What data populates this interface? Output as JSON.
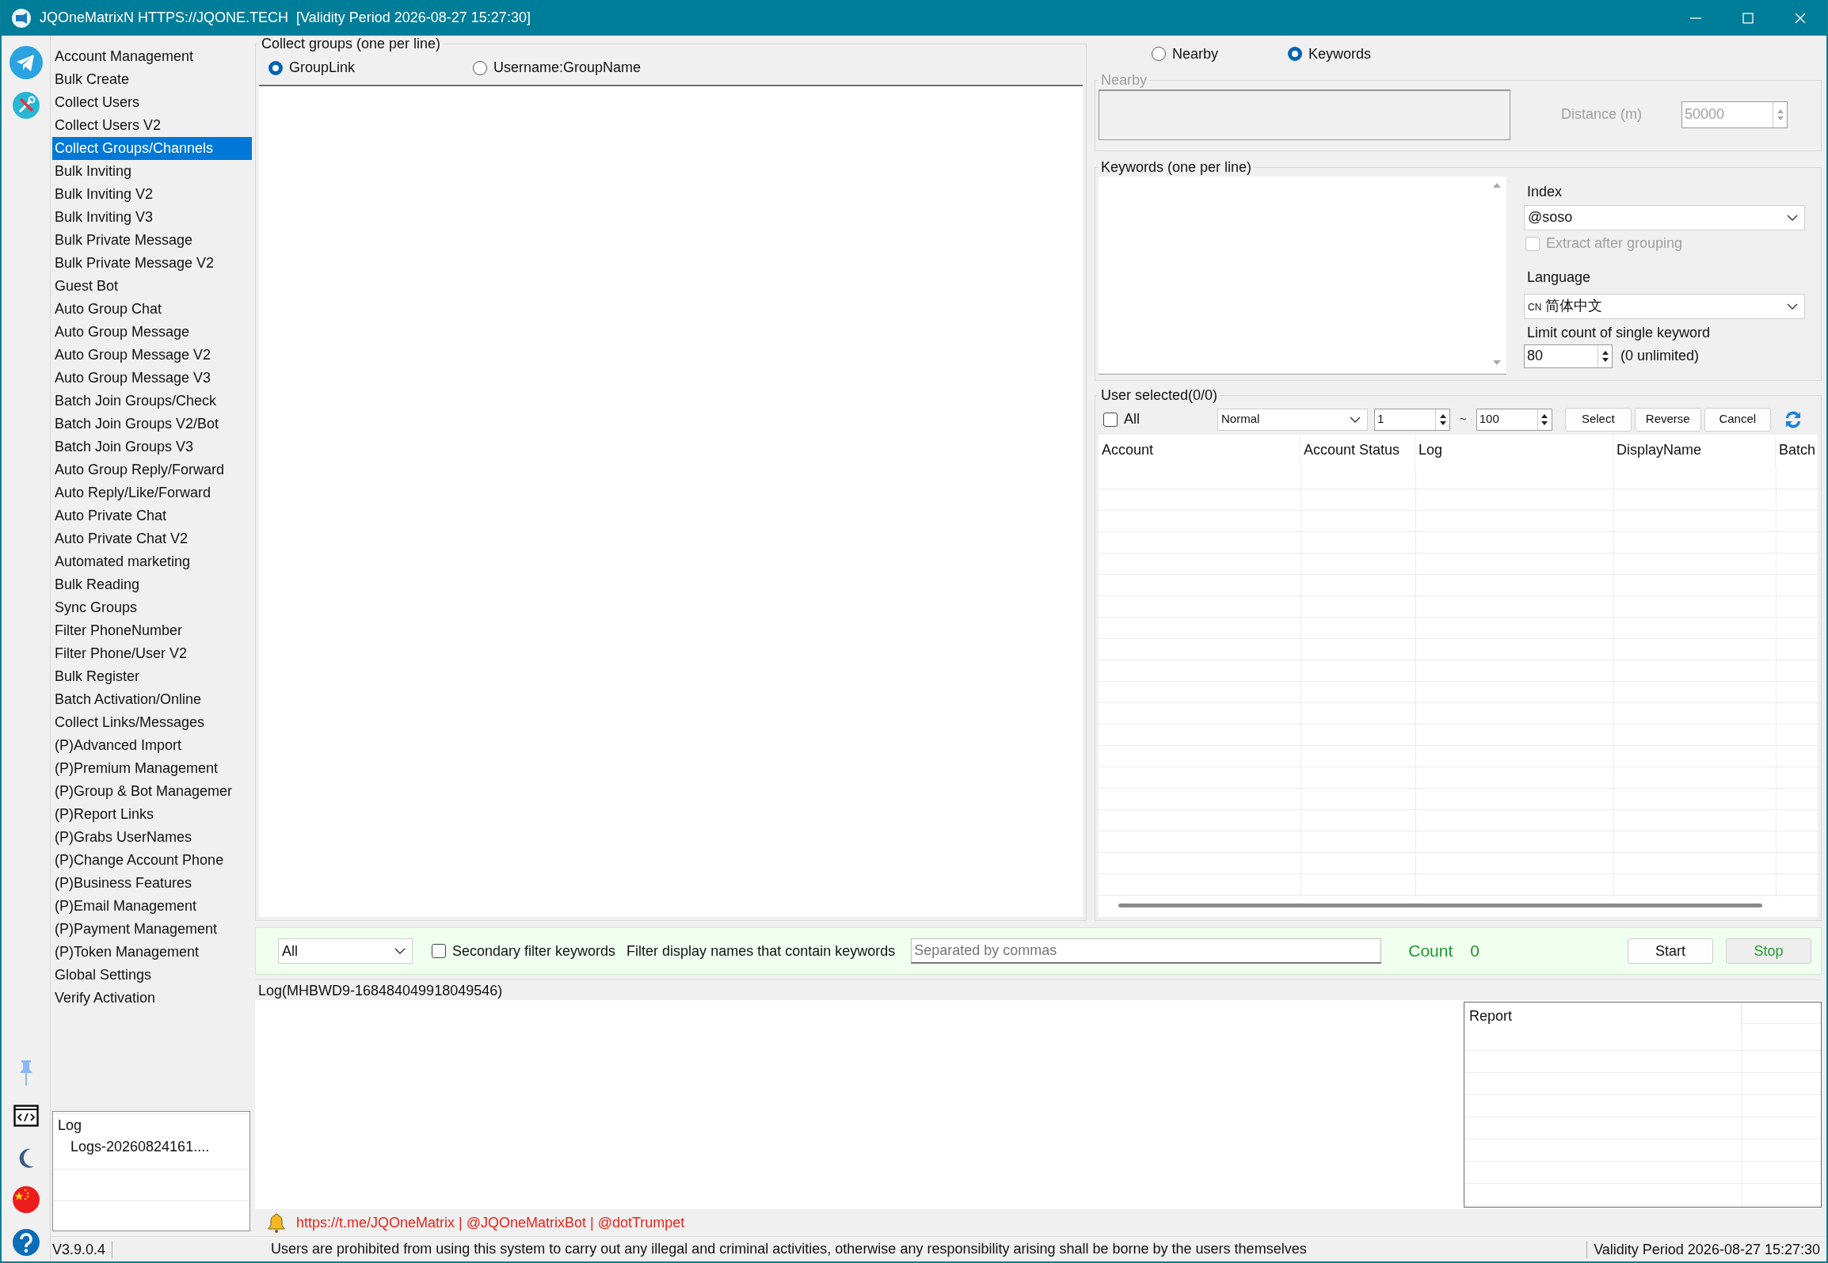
{
  "window": {
    "title": "JQOneMatrixN HTTPS://JQONE.TECH  [Validity Period 2026-08-27 15:27:30]"
  },
  "sidebar": {
    "items": [
      {
        "label": "Account Management",
        "selected": false
      },
      {
        "label": "Bulk Create",
        "selected": false
      },
      {
        "label": "Collect Users",
        "selected": false
      },
      {
        "label": "Collect Users V2",
        "selected": false
      },
      {
        "label": "Collect Groups/Channels",
        "selected": true
      },
      {
        "label": "Bulk Inviting",
        "selected": false
      },
      {
        "label": "Bulk Inviting V2",
        "selected": false
      },
      {
        "label": "Bulk Inviting V3",
        "selected": false
      },
      {
        "label": "Bulk Private Message",
        "selected": false
      },
      {
        "label": "Bulk Private Message V2",
        "selected": false
      },
      {
        "label": "Guest Bot",
        "selected": false
      },
      {
        "label": "Auto Group Chat",
        "selected": false
      },
      {
        "label": "Auto Group Message",
        "selected": false
      },
      {
        "label": "Auto Group Message V2",
        "selected": false
      },
      {
        "label": "Auto Group Message V3",
        "selected": false
      },
      {
        "label": "Batch Join Groups/Check",
        "selected": false
      },
      {
        "label": "Batch Join Groups V2/Bot",
        "selected": false
      },
      {
        "label": "Batch Join Groups V3",
        "selected": false
      },
      {
        "label": "Auto Group Reply/Forward",
        "selected": false
      },
      {
        "label": "Auto Reply/Like/Forward",
        "selected": false
      },
      {
        "label": "Auto Private Chat",
        "selected": false
      },
      {
        "label": "Auto Private Chat V2",
        "selected": false
      },
      {
        "label": "Automated marketing",
        "selected": false
      },
      {
        "label": "Bulk Reading",
        "selected": false
      },
      {
        "label": "Sync Groups",
        "selected": false
      },
      {
        "label": "Filter PhoneNumber",
        "selected": false
      },
      {
        "label": "Filter Phone/User V2",
        "selected": false
      },
      {
        "label": "Bulk Register",
        "selected": false
      },
      {
        "label": "Batch Activation/Online",
        "selected": false
      },
      {
        "label": "Collect Links/Messages",
        "selected": false
      },
      {
        "label": "(P)Advanced Import",
        "selected": false
      },
      {
        "label": "(P)Premium Management",
        "selected": false
      },
      {
        "label": "(P)Group & Bot Managemer",
        "selected": false
      },
      {
        "label": "(P)Report Links",
        "selected": false
      },
      {
        "label": "(P)Grabs UserNames",
        "selected": false
      },
      {
        "label": "(P)Change Account Phone",
        "selected": false
      },
      {
        "label": "(P)Business Features",
        "selected": false
      },
      {
        "label": "(P)Email Management",
        "selected": false
      },
      {
        "label": "(P)Payment Management",
        "selected": false
      },
      {
        "label": "(P)Token Management",
        "selected": false
      },
      {
        "label": "Global Settings",
        "selected": false
      },
      {
        "label": "Verify Activation",
        "selected": false
      }
    ],
    "log_panel": {
      "header": "Log",
      "items": [
        "Logs-20260824161...."
      ]
    }
  },
  "collect_groups": {
    "legend": "Collect groups (one per line)",
    "modes": [
      {
        "label": "GroupLink",
        "selected": true
      },
      {
        "label": "Username:GroupName",
        "selected": false
      }
    ]
  },
  "search_modes": [
    {
      "label": "Nearby",
      "selected": false
    },
    {
      "label": "Keywords",
      "selected": true
    }
  ],
  "nearby": {
    "legend": "Nearby",
    "disabled": true,
    "distance_label": "Distance (m)",
    "distance": "50000"
  },
  "keywords": {
    "legend": "Keywords (one per line)",
    "index_label": "Index",
    "index": "@soso",
    "extract_after_grouping": {
      "label": "Extract after grouping",
      "checked": false,
      "disabled": true
    },
    "language_label": "Language",
    "language_code": "CN",
    "language": "简体中文",
    "limit_label": "Limit count of single keyword",
    "limit": "80",
    "limit_hint": "(0 unlimited)"
  },
  "users": {
    "legend": "User selected(0/0)",
    "all": {
      "label": "All",
      "checked": false
    },
    "filter": "Normal",
    "from": "1",
    "separator": "~",
    "to": "100",
    "buttons": [
      "Select",
      "Reverse",
      "Cancel"
    ],
    "table": {
      "columns": [
        "Account",
        "Account Status",
        "Log",
        "DisplayName",
        "Batch"
      ]
    }
  },
  "filter_bar": {
    "scope": "All",
    "secondary": {
      "label": "Secondary filter keywords",
      "checked": false
    },
    "filter_label": "Filter display names that contain keywords",
    "keywords_placeholder": "Separated by commas",
    "count_label": "Count",
    "count": "0",
    "buttons": [
      {
        "label": "Start",
        "kind": "normal"
      },
      {
        "label": "Stop",
        "kind": "stop"
      }
    ]
  },
  "log": {
    "legend": "Log(MHBWD9-168484049918049546)",
    "report": {
      "columns": [
        "Report"
      ]
    }
  },
  "links": "https://t.me/JQOneMatrix | @JQOneMatrixBot | @dotTrumpet",
  "status_bar": {
    "version": "V3.9.0.4",
    "notice": "Users are prohibited from using this system to carry out any illegal and criminal activities, otherwise any responsibility arising shall be borne by the users themselves",
    "validity": "Validity Period 2026-08-27 15:27:30"
  }
}
